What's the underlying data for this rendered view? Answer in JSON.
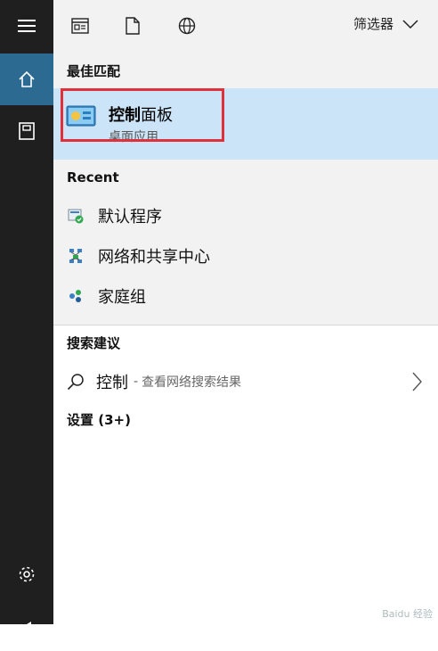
{
  "toolbar": {
    "filter_label": "筛选器"
  },
  "best_match": {
    "heading": "最佳匹配",
    "title_bold": "控制",
    "title_rest": "面板",
    "subtitle": "桌面应用"
  },
  "recent": {
    "heading": "Recent",
    "items": [
      {
        "label": "默认程序",
        "icon": "default-programs-icon"
      },
      {
        "label": "网络和共享中心",
        "icon": "network-sharing-icon"
      },
      {
        "label": "家庭组",
        "icon": "homegroup-icon"
      }
    ]
  },
  "suggestions": {
    "heading": "搜索建议",
    "term": "控制",
    "separator": "-",
    "hint": "查看网络搜索结果"
  },
  "settings": {
    "heading": "设置 (3+)"
  },
  "watermark": "Baidu 经验",
  "colors": {
    "rail": "#1f1f1f",
    "rail_active": "#2c6a92",
    "panel": "#f2f2f2",
    "selected": "#cce4f7",
    "highlight_border": "#e0303a"
  }
}
